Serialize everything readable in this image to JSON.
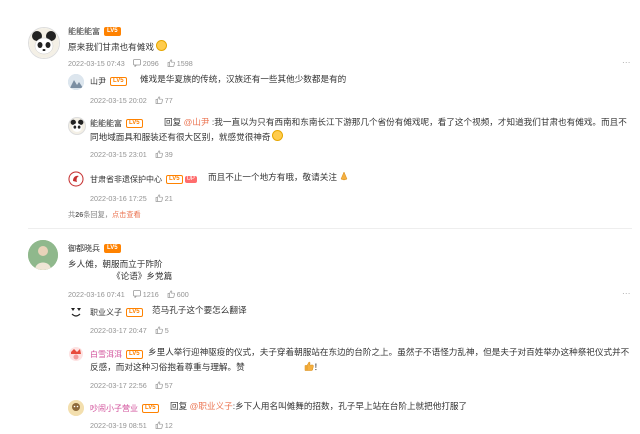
{
  "threads": [
    {
      "main": {
        "user": "能能能富",
        "level": "LV5",
        "text": "原来我们甘肃也有傩戏",
        "date": "2022-03-15 07:43",
        "comments": "2096",
        "likes": "1598"
      },
      "replies": [
        {
          "user": "山尹",
          "level": "LV5",
          "text": "傩戏是华夏族的传统，汉族还有一些其他少数都是有的",
          "date": "2022-03-15 20:02",
          "likes": "77"
        },
        {
          "user": "能能能富",
          "level": "LV5",
          "reply_prefix": "回复",
          "mention": "@山尹",
          "text": ":我一直以为只有西南和东南长江下游那几个省份有傩戏呢，看了这个视频，才知道我们甘肃也有傩戏。而且不同地域面具和服装还有很大区别，就感觉很神奇",
          "date": "2022-03-15 23:01",
          "likes": "39"
        },
        {
          "user": "甘肃省非遗保护中心",
          "level": "LV5",
          "ip_tag": "UP",
          "text": "而且不止一个地方有哦，敬请关注",
          "date": "2022-03-16 17:25",
          "likes": "21"
        }
      ],
      "more": {
        "prefix": "共",
        "count": "26",
        "suffix": "条回复，",
        "link": "点击查看"
      }
    },
    {
      "main": {
        "user": "御都晓兵",
        "level": "LV5",
        "text_line1": "乡人傩，朝服而立于阼阶",
        "text_line2": "《论语》乡党篇",
        "date": "2022-03-16 07:41",
        "comments": "1216",
        "likes": "600"
      },
      "replies": [
        {
          "user": "职业义子",
          "level": "LV5",
          "text": "范马孔子这个要怎么翻译",
          "date": "2022-03-17 20:47",
          "likes": "5"
        },
        {
          "user": "白雪洱洱",
          "level": "LV5",
          "text": "乡里人举行迎神驱疫的仪式，夫子穿着朝服站在东边的台阶之上。虽然子不语怪力乱神，但是夫子对百姓举办这种祭祀仪式并不反感，而对这种习俗抱着尊重与理解。赞",
          "date": "2022-03-17 22:56",
          "likes": "57"
        },
        {
          "user": "吵闹小子营业",
          "level": "LV5",
          "reply_prefix": "回复",
          "mention": "@职业义子",
          "text": ":乡下人用名叫傩舞的招数，孔子早上站在台阶上就把他打服了",
          "date": "2022-03-19 08:51",
          "likes": "12"
        }
      ]
    }
  ],
  "colors": {
    "accent": "#eb7350",
    "level_badge": "#ff8200",
    "meta": "#939393",
    "link": "#eb7350"
  },
  "icons": [
    "comment-icon",
    "like-icon",
    "more-dots-icon"
  ]
}
